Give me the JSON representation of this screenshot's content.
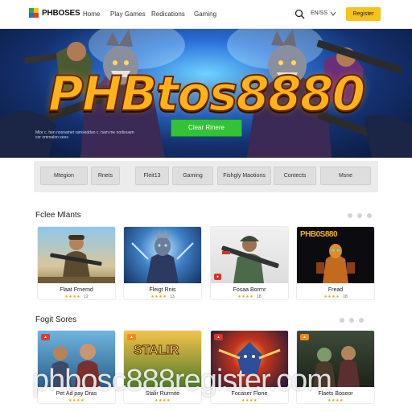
{
  "header": {
    "logo_text": "PHBOSES",
    "nav": [
      "Home",
      "Play Games",
      "Redications",
      "Gaming"
    ],
    "util": "EN/SS",
    "cta": "Register"
  },
  "hero": {
    "title": "PHBtos8880",
    "button": "Clear Rinere",
    "caption": "Mlor c. hen nosnamet ramseddan c. ham me nodiouam cor ommalon sees"
  },
  "filters": [
    "Mtegion",
    "Rnets",
    "Fleit13",
    "Gaming",
    "Fishgly Maotions",
    "Contects",
    "Msne"
  ],
  "sections": [
    {
      "title": "Fclee Mlants",
      "cards": [
        {
          "title": "Flaat Frnemd",
          "rating_value": "12",
          "badge": "",
          "art": "soldier"
        },
        {
          "title": "Fleigt Rnis",
          "rating_value": "13",
          "badge": "",
          "art": "knight"
        },
        {
          "title": "Fosaa Borrnr",
          "rating_value": "18",
          "badge": "",
          "art": "gunner"
        },
        {
          "title": "Fread",
          "rating_value": "18",
          "badge": "",
          "art": "logo",
          "art_text": "PHB0S880"
        }
      ]
    },
    {
      "title": "Fogit Sores",
      "cards": [
        {
          "title": "Pet Ad pay Dras",
          "rating_value": "",
          "badge": "",
          "art": "squad"
        },
        {
          "title": "Stalir Rurmite",
          "rating_value": "",
          "badge": "",
          "art": "stalir",
          "art_text": "STALIR"
        },
        {
          "title": "Focaser Flone",
          "rating_value": "",
          "badge": "",
          "art": "beast"
        },
        {
          "title": "Flaets Boseor",
          "rating_value": "",
          "badge": "",
          "art": "zombie"
        }
      ]
    }
  ],
  "watermark": "phbosc888register.com",
  "colors": {
    "accent": "#f6c21b",
    "hero_button": "#33c238",
    "title_fill": "#ffb21a",
    "title_stroke": "#6a2500",
    "star": "#e7a400"
  }
}
